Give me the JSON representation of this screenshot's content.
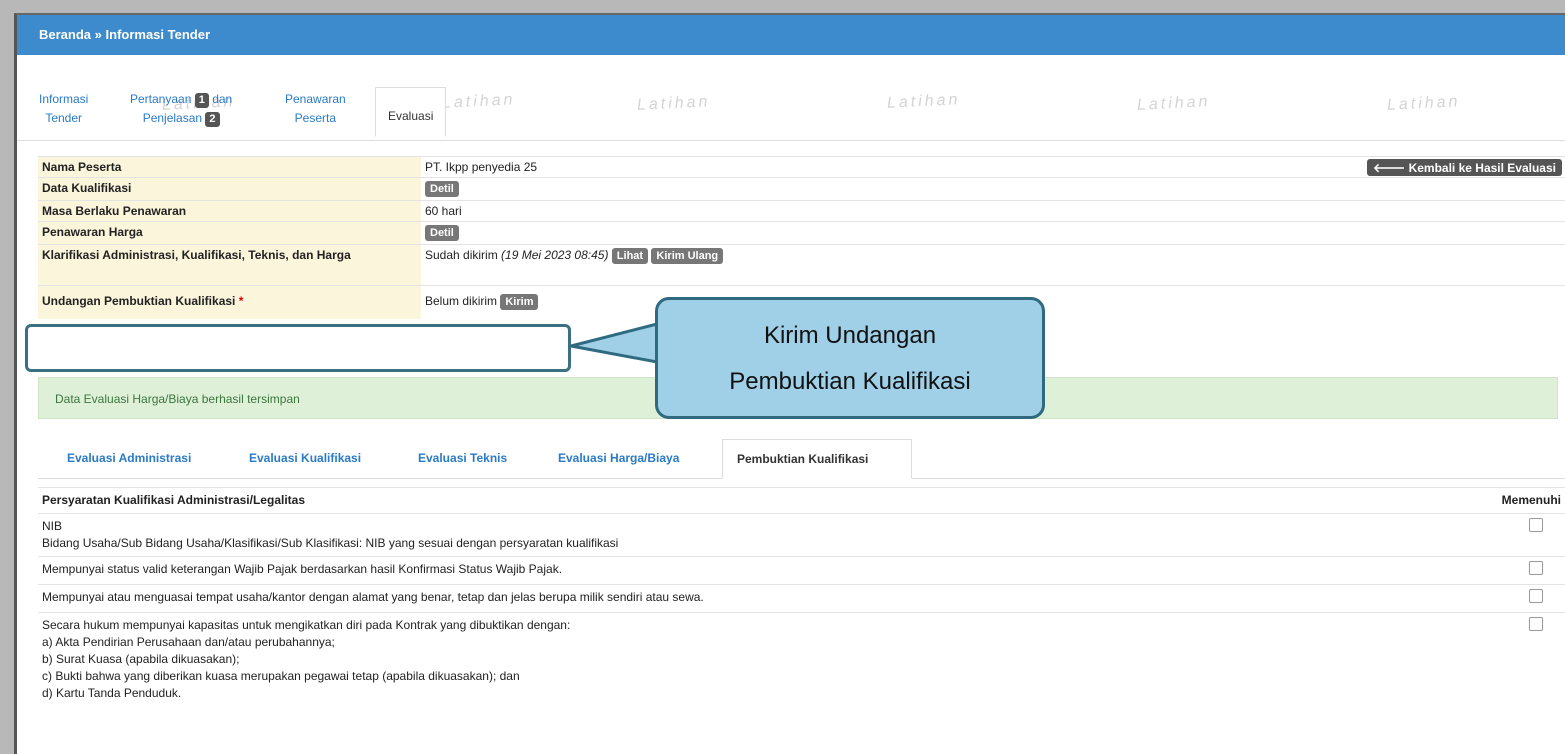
{
  "breadcrumb": {
    "home": "Beranda",
    "sep": "»",
    "current": "Informasi Tender"
  },
  "top_tabs": [
    {
      "line1": "Informasi",
      "line2": "Tender"
    },
    {
      "line1": "Pertanyaan",
      "badge1": "1",
      "line1b": "dan",
      "line2": "Penjelasan",
      "badge2": "2"
    },
    {
      "line1": "Penawaran",
      "line2": "Peserta"
    },
    {
      "line1": "Evaluasi"
    }
  ],
  "watermark": "Latihan",
  "info": {
    "back_button": "Kembali ke Hasil Evaluasi",
    "rows": [
      {
        "label": "Nama Peserta",
        "value": "PT. Ikpp penyedia 25"
      },
      {
        "label": "Data Kualifikasi",
        "button": "Detil"
      },
      {
        "label": "Masa Berlaku Penawaran",
        "value": "60 hari"
      },
      {
        "label": "Penawaran Harga",
        "button": "Detil"
      },
      {
        "label": "Klarifikasi Administrasi, Kualifikasi, Teknis, dan Harga",
        "value": "Sudah dikirim",
        "date": "(19 Mei 2023 08:45)",
        "btn1": "Lihat",
        "btn2": "Kirim Ulang"
      },
      {
        "label": "Undangan Pembuktian Kualifikasi",
        "required": "*",
        "value": "Belum dikirim",
        "button": "Kirim"
      }
    ]
  },
  "alert": "Data Evaluasi Harga/Biaya berhasil tersimpan",
  "callout": {
    "line1": "Kirim Undangan",
    "line2": "Pembuktian Kualifikasi"
  },
  "sub_tabs": [
    "Evaluasi Administrasi",
    "Evaluasi Kualifikasi",
    "Evaluasi Teknis",
    "Evaluasi Harga/Biaya",
    "Pembuktian Kualifikasi"
  ],
  "requirements": {
    "header": "Persyaratan Kualifikasi Administrasi/Legalitas",
    "col_meets": "Memenuhi",
    "rows": [
      {
        "lines": [
          "NIB",
          "Bidang Usaha/Sub Bidang Usaha/Klasifikasi/Sub Klasifikasi: NIB yang sesuai dengan persyaratan kualifikasi"
        ]
      },
      {
        "lines": [
          "Mempunyai status valid keterangan Wajib Pajak berdasarkan hasil Konfirmasi Status Wajib Pajak."
        ]
      },
      {
        "lines": [
          "Mempunyai atau menguasai tempat usaha/kantor dengan alamat yang benar, tetap dan jelas berupa milik sendiri atau sewa."
        ]
      },
      {
        "lines": [
          "Secara hukum mempunyai kapasitas untuk mengikatkan diri pada Kontrak yang dibuktikan dengan:",
          "a) Akta Pendirian Perusahaan dan/atau perubahannya;",
          "b) Surat Kuasa (apabila dikuasakan);",
          "c) Bukti bahwa yang diberikan kuasa merupakan pegawai tetap (apabila dikuasakan); dan",
          "d) Kartu Tanda Penduduk."
        ]
      }
    ]
  }
}
